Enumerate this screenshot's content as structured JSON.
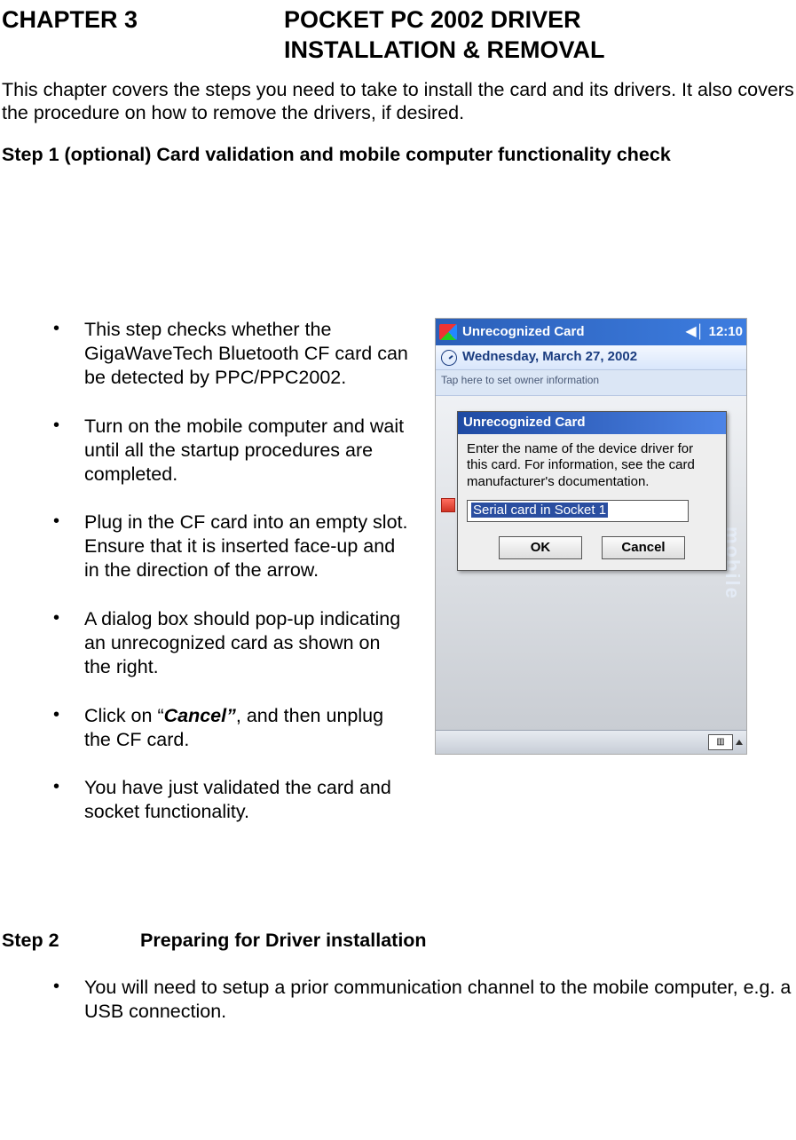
{
  "chapter": {
    "label": "CHAPTER 3",
    "title_line1": "POCKET PC 2002 DRIVER",
    "title_line2": "INSTALLATION & REMOVAL"
  },
  "intro": "This chapter covers the steps you need to take to install the card and its drivers.  It also covers the procedure on how to remove the drivers, if desired.",
  "step1": {
    "heading": "Step 1 (optional)     Card validation and mobile computer functionality check",
    "bullets": [
      "This step checks whether the GigaWaveTech Bluetooth CF card can be detected by PPC/PPC2002.",
      "Turn on the mobile computer and wait until all the startup procedures are completed.",
      "Plug in the CF card into an empty slot.  Ensure that it is inserted face-up and in the direction of the arrow.",
      "A dialog box should pop-up indicating an unrecognized card as shown on the right."
    ],
    "bullets_after": [
      {
        "prefix": "Click on “",
        "emph": "Cancel”",
        "suffix": ", and then unplug the CF card."
      },
      {
        "plain": "You have just validated the card and socket functionality."
      }
    ]
  },
  "screenshot": {
    "top_title": "Unrecognized Card",
    "time": "12:10",
    "date": "Wednesday, March 27, 2002",
    "owner_strip": "Tap here to set owner information",
    "side_text": "mobile",
    "dialog": {
      "title": "Unrecognized Card",
      "message": "Enter the name of the device driver for this card. For information, see the card manufacturer's documentation.",
      "input_value": "Serial card in Socket 1",
      "ok": "OK",
      "cancel": "Cancel"
    }
  },
  "step2": {
    "label": "Step 2",
    "title": "Preparing for Driver installation",
    "bullet": "You will need to setup a prior communication channel to the mobile computer, e.g. a USB connection."
  }
}
